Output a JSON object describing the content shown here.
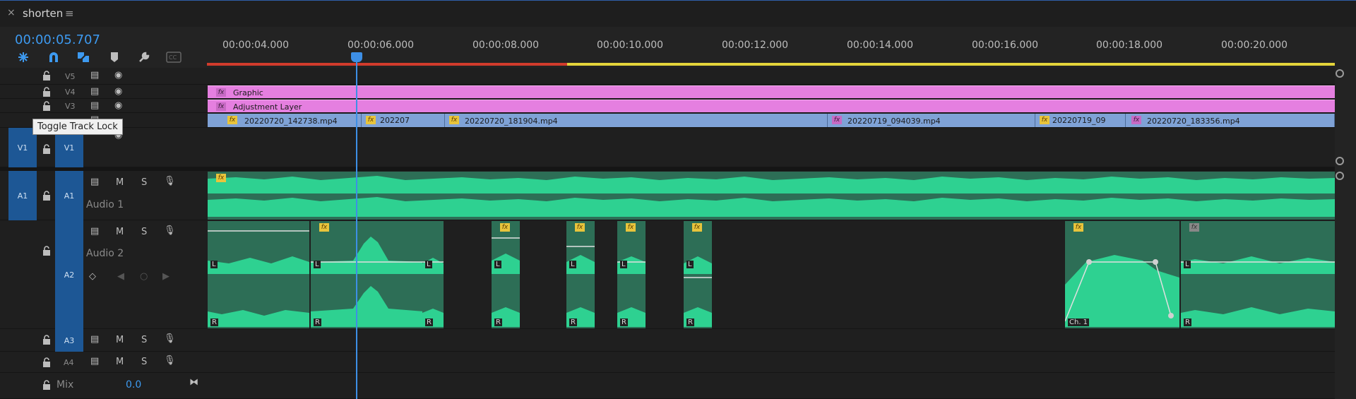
{
  "panel": {
    "title": "shorten",
    "close_glyph": "×",
    "menu_glyph": "≡"
  },
  "timecode": "00:00:05.707",
  "ruler": {
    "labels": [
      "00:00:04.000",
      "00:00:06.000",
      "00:00:08.000",
      "00:00:10.000",
      "00:00:12.000",
      "00:00:14.000",
      "00:00:16.000",
      "00:00:18.000",
      "00:00:20.000"
    ]
  },
  "tracks": {
    "v5": "V5",
    "v4": "V4",
    "v3": "V3",
    "v1_src": "V1",
    "v1": "V1",
    "a1_src": "A1",
    "a1": "A1",
    "a1_name": "Audio 1",
    "a2": "A2",
    "a2_name": "Audio 2",
    "a3": "A3",
    "a4": "A4",
    "mix_label": "Mix",
    "mix_value": "0.0",
    "m": "M",
    "s": "S"
  },
  "tooltip": "Toggle Track Lock",
  "clips": {
    "graphic": "Graphic",
    "adjustment": "Adjustment Layer",
    "fx": "fx",
    "v2": [
      {
        "label": "20220720_142738.mp4"
      },
      {
        "label": "202207"
      },
      {
        "label": "20220720_181904.mp4"
      },
      {
        "label": "20220719_094039.mp4"
      },
      {
        "label": "20220719_09"
      },
      {
        "label": "20220720_183356.mp4"
      }
    ],
    "channel_l": "L",
    "channel_r": "R",
    "ch1": "Ch. 1"
  },
  "colors": {
    "accent": "#3d9af0",
    "graphic_clip": "#e57fe0",
    "video_clip": "#7fa2d6",
    "audio_clip": "#2d6e56",
    "waveform": "#2ed191"
  }
}
